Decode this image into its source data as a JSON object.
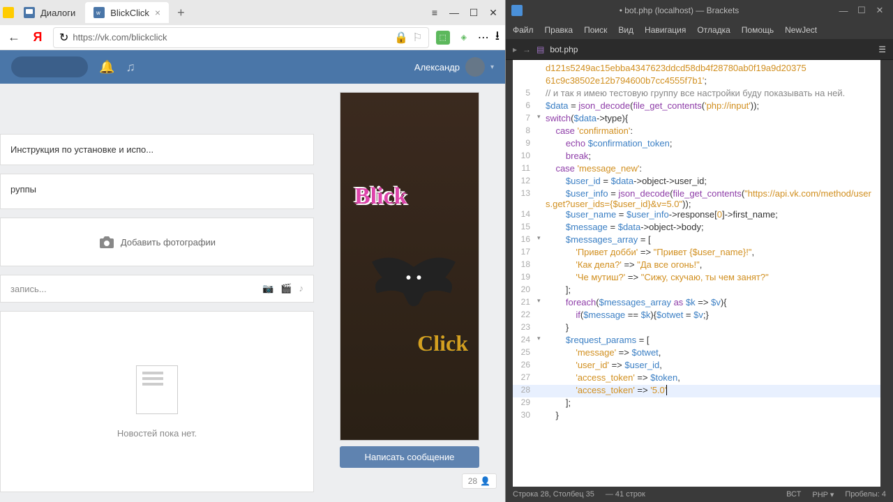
{
  "browser": {
    "tabs": [
      {
        "label": "Диалоги",
        "active": false
      },
      {
        "label": "BlickClick",
        "active": true
      }
    ],
    "url": "https://vk.com/blickclick"
  },
  "vk": {
    "user": "Александр",
    "left": {
      "instruction": "Инструкция по установке и испо...",
      "groups_label": "руппы",
      "add_photo": "Добавить фотографии",
      "write_post_placeholder": "запись...",
      "no_news": "Новостей пока нет."
    },
    "right": {
      "text_blick": "Blick",
      "text_click": "Click",
      "write_message": "Написать сообщение",
      "subscribers": "28"
    }
  },
  "brackets": {
    "title": "• bot.php (localhost) — Brackets",
    "menu": [
      "Файл",
      "Правка",
      "Поиск",
      "Вид",
      "Навигация",
      "Отладка",
      "Помощь",
      "NewJect"
    ],
    "file_tab": "bot.php",
    "status": {
      "cursor": "Строка 28, Столбец 35",
      "lines": "— 41 строк",
      "insert": "ВСТ",
      "lang": "PHP",
      "spaces": "Пробелы: 4"
    },
    "code": [
      {
        "ln": "",
        "content": [
          [
            "str",
            "d121s5249ac15ebba4347623ddcd58db4f28780ab0f19a9d20375"
          ]
        ]
      },
      {
        "ln": "",
        "content": [
          [
            "str",
            "61c9c38502e12b794600b7cc4555f7b1'"
          ],
          [
            "op",
            ";"
          ]
        ]
      },
      {
        "ln": "5",
        "content": [
          [
            "com",
            "// и так я имею тестовую группу все настройки буду показывать на ней."
          ]
        ]
      },
      {
        "ln": "6",
        "content": [
          [
            "var",
            "$data"
          ],
          [
            "op",
            " = "
          ],
          [
            "kw",
            "json_decode"
          ],
          [
            "op",
            "("
          ],
          [
            "kw",
            "file_get_contents"
          ],
          [
            "op",
            "("
          ],
          [
            "str",
            "'php://input'"
          ],
          [
            "op",
            "));"
          ]
        ]
      },
      {
        "ln": "7",
        "fold": "▾",
        "content": [
          [
            "kw",
            "switch"
          ],
          [
            "op",
            "("
          ],
          [
            "var",
            "$data"
          ],
          [
            "op",
            "->type){"
          ]
        ]
      },
      {
        "ln": "8",
        "content": [
          [
            "op",
            "    "
          ],
          [
            "kw",
            "case"
          ],
          [
            "op",
            " "
          ],
          [
            "str",
            "'confirmation'"
          ],
          [
            "op",
            ":"
          ]
        ]
      },
      {
        "ln": "9",
        "content": [
          [
            "op",
            "        "
          ],
          [
            "kw",
            "echo"
          ],
          [
            "op",
            " "
          ],
          [
            "var",
            "$confirmation_token"
          ],
          [
            "op",
            ";"
          ]
        ]
      },
      {
        "ln": "10",
        "content": [
          [
            "op",
            "        "
          ],
          [
            "kw",
            "break"
          ],
          [
            "op",
            ";"
          ]
        ]
      },
      {
        "ln": "11",
        "content": [
          [
            "op",
            "    "
          ],
          [
            "kw",
            "case"
          ],
          [
            "op",
            " "
          ],
          [
            "str",
            "'message_new'"
          ],
          [
            "op",
            ":"
          ]
        ]
      },
      {
        "ln": "12",
        "content": [
          [
            "op",
            "        "
          ],
          [
            "var",
            "$user_id"
          ],
          [
            "op",
            " = "
          ],
          [
            "var",
            "$data"
          ],
          [
            "op",
            "->object->user_id;"
          ]
        ]
      },
      {
        "ln": "13",
        "content": [
          [
            "op",
            "        "
          ],
          [
            "var",
            "$user_info"
          ],
          [
            "op",
            " = "
          ],
          [
            "kw",
            "json_decode"
          ],
          [
            "op",
            "("
          ],
          [
            "kw",
            "file_get_contents"
          ],
          [
            "op",
            "("
          ],
          [
            "str",
            "\"https://api.vk.com/method/users.get?user_ids={$user_id}&v=5.0\""
          ],
          [
            "op",
            "));"
          ]
        ]
      },
      {
        "ln": "14",
        "content": [
          [
            "op",
            "        "
          ],
          [
            "var",
            "$user_name"
          ],
          [
            "op",
            " = "
          ],
          [
            "var",
            "$user_info"
          ],
          [
            "op",
            "->response["
          ],
          [
            "str",
            "0"
          ],
          [
            "op",
            "]->first_name;"
          ]
        ]
      },
      {
        "ln": "15",
        "content": [
          [
            "op",
            "        "
          ],
          [
            "var",
            "$message"
          ],
          [
            "op",
            " = "
          ],
          [
            "var",
            "$data"
          ],
          [
            "op",
            "->object->body;"
          ]
        ]
      },
      {
        "ln": "16",
        "fold": "▾",
        "content": [
          [
            "op",
            "        "
          ],
          [
            "var",
            "$messages_array"
          ],
          [
            "op",
            " = ["
          ]
        ]
      },
      {
        "ln": "17",
        "content": [
          [
            "op",
            "            "
          ],
          [
            "str",
            "'Привет добби'"
          ],
          [
            "op",
            " => "
          ],
          [
            "str",
            "\"Привет {$user_name}!\""
          ],
          [
            "op",
            ","
          ]
        ]
      },
      {
        "ln": "18",
        "content": [
          [
            "op",
            "            "
          ],
          [
            "str",
            "'Как дела?'"
          ],
          [
            "op",
            " => "
          ],
          [
            "str",
            "\"Да все огонь!\""
          ],
          [
            "op",
            ","
          ]
        ]
      },
      {
        "ln": "19",
        "content": [
          [
            "op",
            "            "
          ],
          [
            "str",
            "'Че мутиш?'"
          ],
          [
            "op",
            " => "
          ],
          [
            "str",
            "\"Сижу, скучаю, ты чем занят?\""
          ]
        ]
      },
      {
        "ln": "20",
        "content": [
          [
            "op",
            "        ];"
          ]
        ]
      },
      {
        "ln": "21",
        "fold": "▾",
        "content": [
          [
            "op",
            "        "
          ],
          [
            "kw",
            "foreach"
          ],
          [
            "op",
            "("
          ],
          [
            "var",
            "$messages_array"
          ],
          [
            "op",
            " "
          ],
          [
            "kw",
            "as"
          ],
          [
            "op",
            " "
          ],
          [
            "var",
            "$k"
          ],
          [
            "op",
            " => "
          ],
          [
            "var",
            "$v"
          ],
          [
            "op",
            "){"
          ]
        ]
      },
      {
        "ln": "22",
        "content": [
          [
            "op",
            "            "
          ],
          [
            "kw",
            "if"
          ],
          [
            "op",
            "("
          ],
          [
            "var",
            "$message"
          ],
          [
            "op",
            " == "
          ],
          [
            "var",
            "$k"
          ],
          [
            "op",
            "){"
          ],
          [
            "var",
            "$otwet"
          ],
          [
            "op",
            " = "
          ],
          [
            "var",
            "$v"
          ],
          [
            "op",
            ";}"
          ]
        ]
      },
      {
        "ln": "23",
        "content": [
          [
            "op",
            "        }"
          ]
        ]
      },
      {
        "ln": "24",
        "fold": "▾",
        "content": [
          [
            "op",
            "        "
          ],
          [
            "var",
            "$request_params"
          ],
          [
            "op",
            " = ["
          ]
        ]
      },
      {
        "ln": "25",
        "content": [
          [
            "op",
            "            "
          ],
          [
            "str",
            "'message'"
          ],
          [
            "op",
            " => "
          ],
          [
            "var",
            "$otwet"
          ],
          [
            "op",
            ","
          ]
        ]
      },
      {
        "ln": "26",
        "content": [
          [
            "op",
            "            "
          ],
          [
            "str",
            "'user_id'"
          ],
          [
            "op",
            " => "
          ],
          [
            "var",
            "$user_id"
          ],
          [
            "op",
            ","
          ]
        ]
      },
      {
        "ln": "27",
        "content": [
          [
            "op",
            "            "
          ],
          [
            "str",
            "'access_token'"
          ],
          [
            "op",
            " => "
          ],
          [
            "var",
            "$token"
          ],
          [
            "op",
            ","
          ]
        ]
      },
      {
        "ln": "28",
        "cursor": true,
        "content": [
          [
            "op",
            "            "
          ],
          [
            "str",
            "'access_token'"
          ],
          [
            "op",
            " => "
          ],
          [
            "str",
            "'5.0'"
          ]
        ]
      },
      {
        "ln": "29",
        "content": [
          [
            "op",
            "        ];"
          ]
        ]
      },
      {
        "ln": "30",
        "content": [
          [
            "op",
            "    }"
          ]
        ]
      }
    ]
  }
}
